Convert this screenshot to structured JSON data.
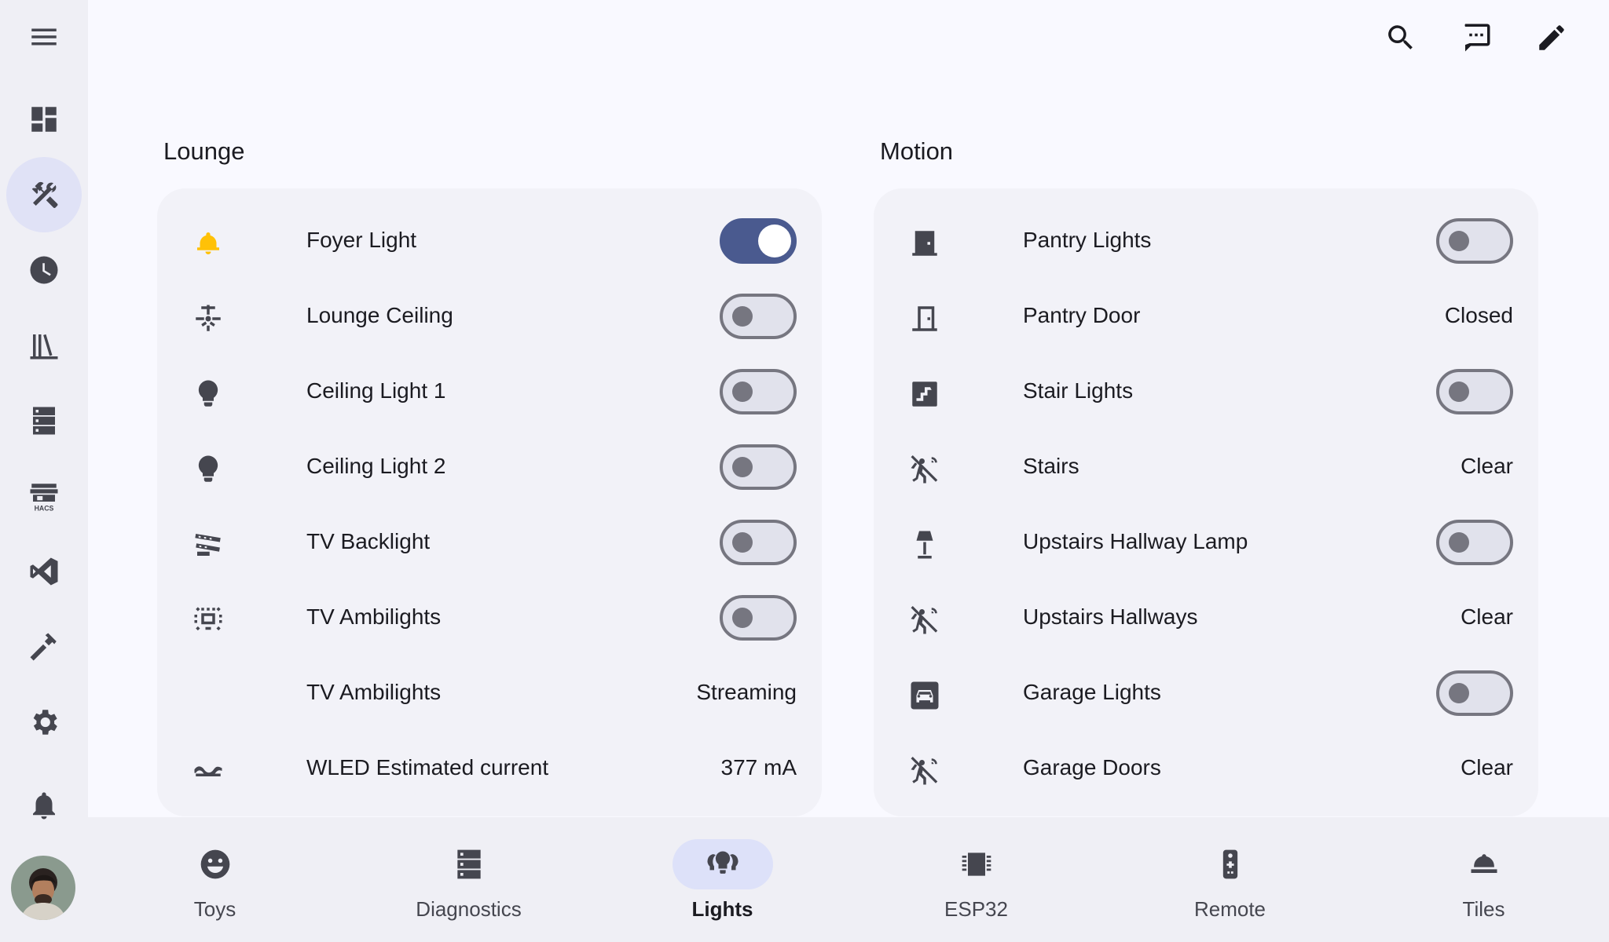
{
  "sidebar": {
    "items": [
      {
        "name": "menu-icon"
      },
      {
        "name": "dashboard-icon"
      },
      {
        "name": "tools-icon"
      },
      {
        "name": "history-icon"
      },
      {
        "name": "library-icon"
      },
      {
        "name": "server-icon"
      },
      {
        "name": "hacs-icon",
        "label": "HACS"
      },
      {
        "name": "vscode-icon"
      },
      {
        "name": "hammer-icon"
      },
      {
        "name": "gear-icon"
      },
      {
        "name": "bell-icon"
      }
    ]
  },
  "topbar": {
    "icons": [
      "search-icon",
      "assist-icon",
      "edit-pencil-icon"
    ]
  },
  "sections": {
    "lounge": {
      "title": "Lounge",
      "rows": [
        {
          "icon": "bell-light-icon",
          "label": "Foyer Light",
          "type": "toggle",
          "state": "on"
        },
        {
          "icon": "ceiling-fan-icon",
          "label": "Lounge Ceiling",
          "type": "toggle",
          "state": "off"
        },
        {
          "icon": "bulb-icon",
          "label": "Ceiling Light 1",
          "type": "toggle",
          "state": "off"
        },
        {
          "icon": "bulb-icon",
          "label": "Ceiling Light 2",
          "type": "toggle",
          "state": "off"
        },
        {
          "icon": "led-strip-icon",
          "label": "TV Backlight",
          "type": "toggle",
          "state": "off"
        },
        {
          "icon": "tv-ambilight-icon",
          "label": "TV Ambilights",
          "type": "toggle",
          "state": "off"
        },
        {
          "icon": "",
          "label": "TV Ambilights",
          "type": "value",
          "value": "Streaming"
        },
        {
          "icon": "current-ac-icon",
          "label": "WLED Estimated current",
          "type": "value",
          "value": "377 mA"
        }
      ]
    },
    "motion": {
      "title": "Motion",
      "rows": [
        {
          "icon": "door-closed-icon",
          "label": "Pantry Lights",
          "type": "toggle",
          "state": "off"
        },
        {
          "icon": "door-icon",
          "label": "Pantry Door",
          "type": "value",
          "value": "Closed"
        },
        {
          "icon": "stairs-icon",
          "label": "Stair Lights",
          "type": "toggle",
          "state": "off"
        },
        {
          "icon": "motion-sensor-off-icon",
          "label": "Stairs",
          "type": "value",
          "value": "Clear"
        },
        {
          "icon": "lamp-icon",
          "label": "Upstairs Hallway Lamp",
          "type": "toggle",
          "state": "off"
        },
        {
          "icon": "motion-sensor-off-icon",
          "label": "Upstairs Hallways",
          "type": "value",
          "value": "Clear"
        },
        {
          "icon": "car-icon",
          "label": "Garage Lights",
          "type": "toggle",
          "state": "off"
        },
        {
          "icon": "motion-sensor-off-icon",
          "label": "Garage Doors",
          "type": "value",
          "value": "Clear"
        }
      ]
    }
  },
  "tabs": [
    {
      "icon": "emoticon-icon",
      "label": "Toys"
    },
    {
      "icon": "server-icon",
      "label": "Diagnostics"
    },
    {
      "icon": "lights-group-icon",
      "label": "Lights",
      "active": true
    },
    {
      "icon": "chip-icon",
      "label": "ESP32"
    },
    {
      "icon": "remote-icon",
      "label": "Remote"
    },
    {
      "icon": "tiles-icon",
      "label": "Tiles"
    }
  ],
  "colors": {
    "accent": "#4a5a8f",
    "foyer_light": "#ffc107",
    "background": "#f9f9ff",
    "card": "#f2f2f8",
    "sidebar": "#efeff5"
  }
}
